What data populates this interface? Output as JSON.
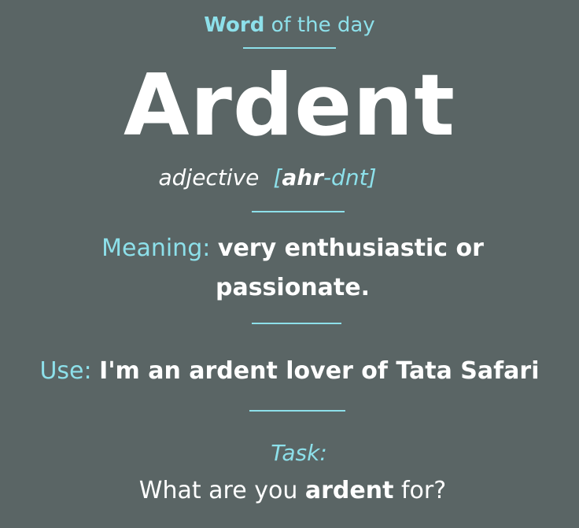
{
  "header": {
    "word_bold": "Word",
    "rest": "of the day"
  },
  "word": "Ardent",
  "part_of_speech": "adjective",
  "pronunciation": {
    "open": "[",
    "stressed": "ahr",
    "rest": "-dnt",
    "close": "]"
  },
  "meaning": {
    "label": "Meaning:",
    "text_line1": "very enthusiastic or",
    "text_line2": "passionate."
  },
  "use": {
    "label": "Use:",
    "text": "I'm an ardent lover of Tata Safari"
  },
  "task": {
    "label": "Task:",
    "question_pre": "What are you",
    "question_bold": "ardent",
    "question_post": "for?"
  },
  "colors": {
    "background": "#5a6565",
    "accent": "#8de0ea",
    "text": "#ffffff"
  }
}
